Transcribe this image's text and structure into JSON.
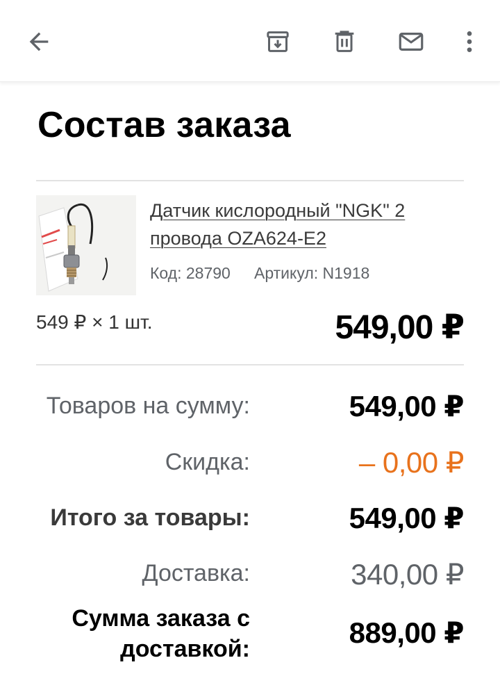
{
  "toolbar": {
    "back_icon": "arrow-left-icon",
    "archive_icon": "archive-icon",
    "delete_icon": "trash-icon",
    "mail_icon": "mail-icon",
    "more_icon": "more-vert-icon"
  },
  "order": {
    "title": "Состав заказа",
    "item": {
      "name": "Датчик кислородный \"NGK\" 2 провода OZA624-E2",
      "code": "Код: 28790",
      "article": "Артикул: N1918",
      "qty_price": "549 ₽ × 1 шт.",
      "line_total": "549,00 ₽"
    },
    "summary": {
      "goods_label": "Товаров на сумму:",
      "goods_value": "549,00 ₽",
      "discount_label": "Скидка:",
      "discount_value": "– 0,00 ₽",
      "subtotal_label": "Итого за товары:",
      "subtotal_value": "549,00 ₽",
      "delivery_label": "Доставка:",
      "delivery_value": "340,00 ₽",
      "total_label": "Сумма заказа с доставкой:",
      "total_value": "889,00 ₽"
    }
  },
  "colors": {
    "discount": "#e8721c",
    "muted": "#5f6368",
    "divider": "#e2e2e2"
  }
}
